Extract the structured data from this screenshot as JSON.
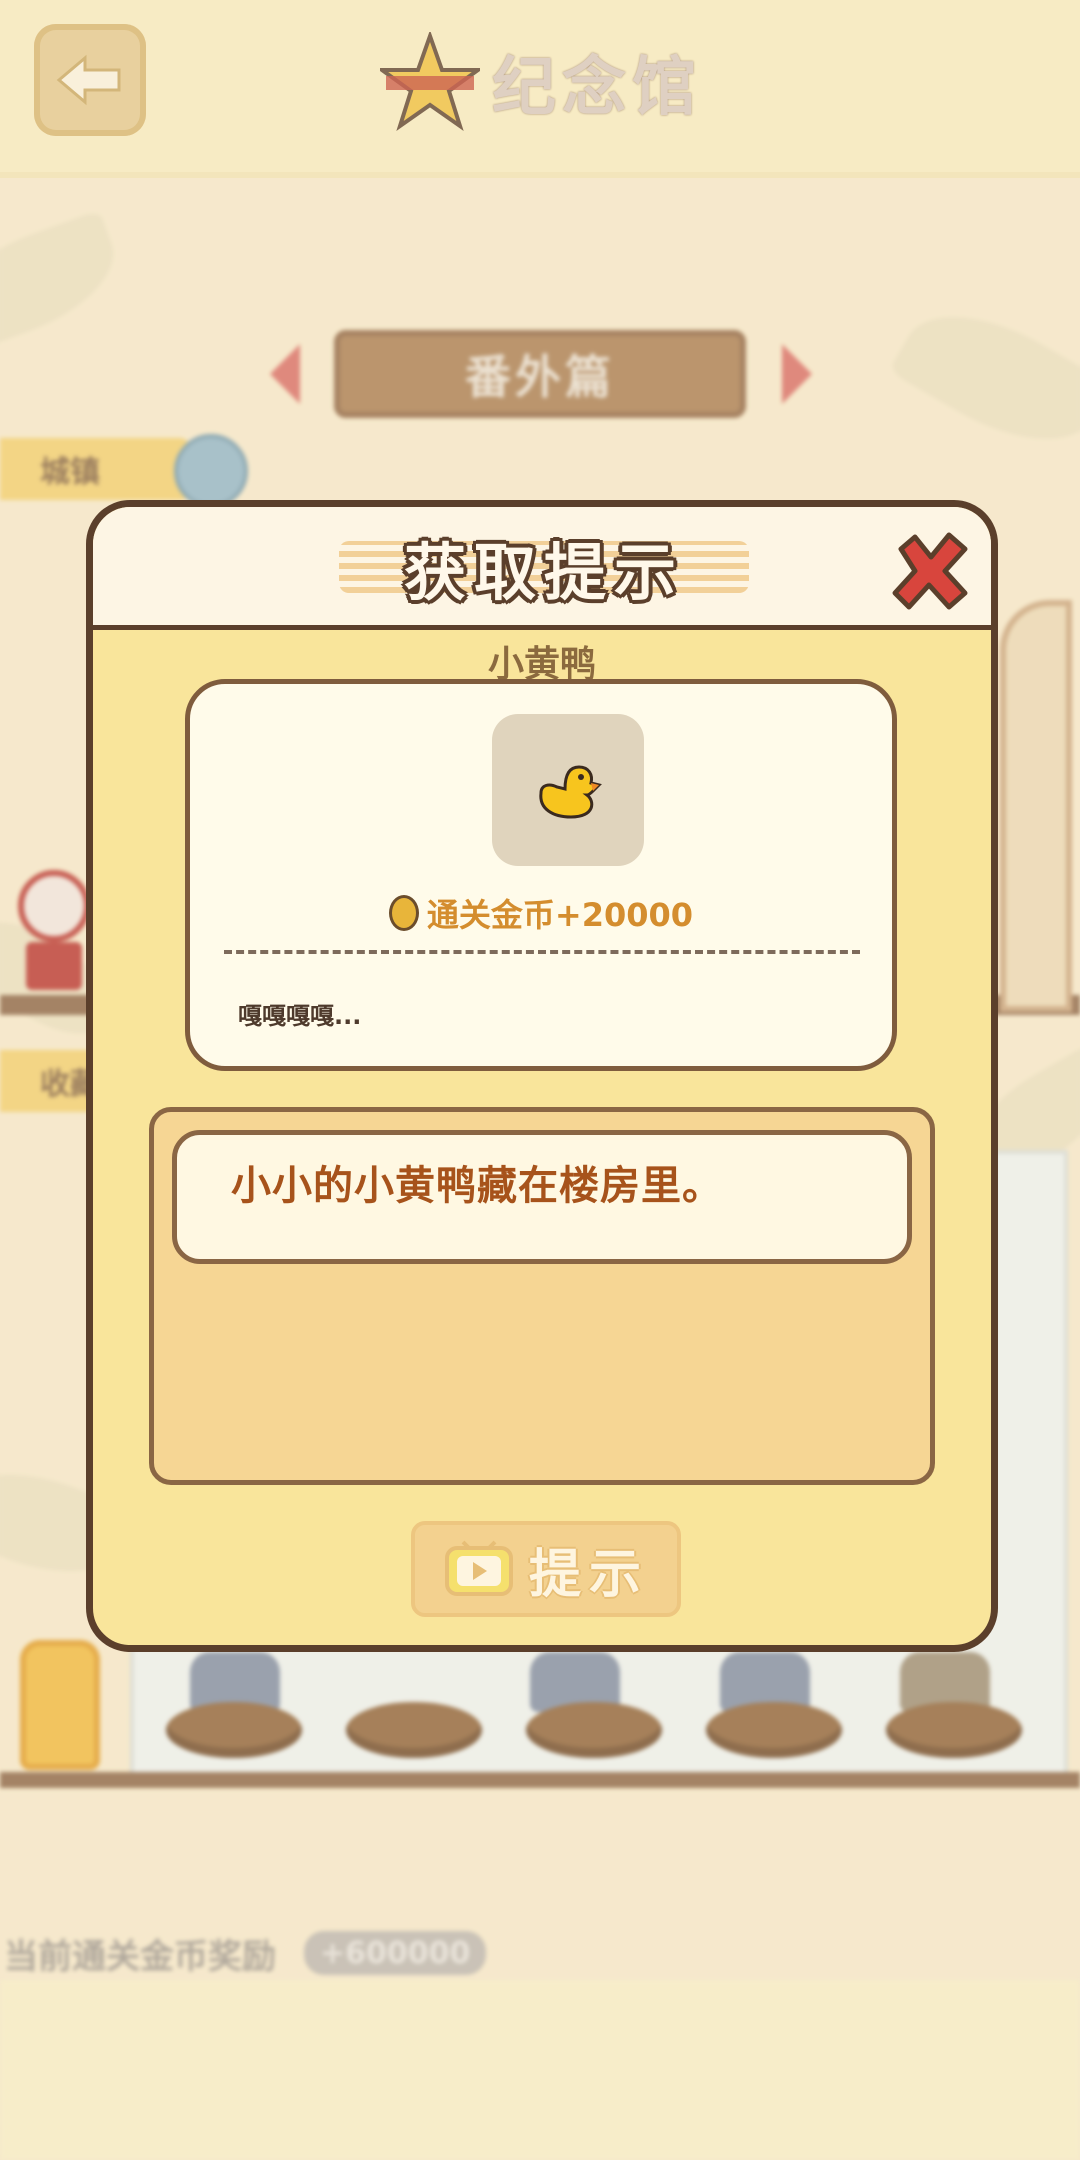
{
  "header": {
    "title": "纪念馆"
  },
  "background": {
    "category": "番外篇",
    "side_tag_top": "城镇",
    "side_tag_mid": "收藏",
    "progress_label": "当前通关金币奖励",
    "progress_value": "+600000"
  },
  "dialog": {
    "title": "获取提示",
    "item_name": "小黄鸭",
    "reward_label": "通关金币+20000",
    "item_desc": "嘎嘎嘎嘎...",
    "hint_text": "小小的小黄鸭藏在楼房里。",
    "hint_button_label": "提示"
  },
  "colors": {
    "dialog_fill": "#f9e59b",
    "dialog_border": "#5b3f2b",
    "hint_text": "#a7531b",
    "reward_text": "#d48d2e",
    "close_red": "#d8453d"
  }
}
